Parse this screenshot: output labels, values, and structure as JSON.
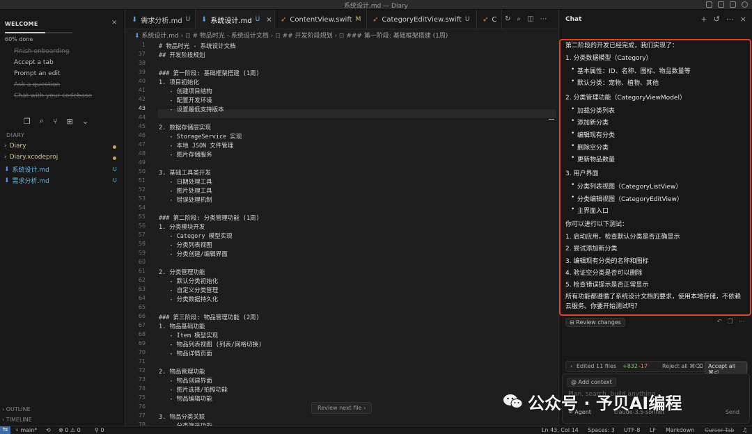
{
  "window": {
    "title": "系统设计.md — Diary"
  },
  "sidebar": {
    "welcome": {
      "title": "WELCOME",
      "progress_text": "60% done",
      "progress": 0.6
    },
    "onboarding": [
      {
        "label": "Finish onboarding",
        "done": true
      },
      {
        "label": "Accept a tab",
        "done": false
      },
      {
        "label": "Prompt an edit",
        "done": false
      },
      {
        "label": "Ask a question",
        "done": true
      },
      {
        "label": "Chat with your codebase",
        "done": true
      }
    ],
    "section": "DIARY",
    "files": [
      {
        "name": "Diary",
        "type": "folder",
        "status": "dot"
      },
      {
        "name": "Diary.xcodeproj",
        "type": "folder",
        "status": "dot"
      },
      {
        "name": "系统设计.md",
        "type": "md",
        "status": "U"
      },
      {
        "name": "需求分析.md",
        "type": "md",
        "status": "U"
      }
    ],
    "outline": "OUTLINE",
    "timeline": "TIMELINE"
  },
  "tabs": [
    {
      "label": "需求分析.md",
      "status": "U",
      "icon": "markdown-icon"
    },
    {
      "label": "系统设计.md",
      "status": "U",
      "icon": "markdown-icon",
      "active": true
    },
    {
      "label": "ContentView.swift",
      "status": "M",
      "icon": "swift-icon"
    },
    {
      "label": "CategoryEditView.swift",
      "status": "U",
      "icon": "swift-icon"
    },
    {
      "label": "C",
      "status": "",
      "icon": "swift-icon"
    }
  ],
  "breadcrumb": {
    "file": "系统设计.md",
    "h1": "# 物品时光 - 系统设计文档",
    "h2": "## 开发阶段规划",
    "h3": "### 第一阶段: 基础框架搭建 (1周)"
  },
  "editor": {
    "current_line": 43,
    "lines": [
      {
        "n": 1,
        "text": "# 物品时光 - 系统设计文档"
      },
      {
        "n": 37,
        "text": "## 开发阶段规划"
      },
      {
        "n": 38,
        "text": ""
      },
      {
        "n": 39,
        "text": "### 第一阶段: 基础框架搭建 (1周)"
      },
      {
        "n": 40,
        "text": "1. 项目初始化"
      },
      {
        "n": 41,
        "text": "   - 创建项目结构"
      },
      {
        "n": 42,
        "text": "   - 配置开发环境"
      },
      {
        "n": 43,
        "text": "   - 设置最低支持版本"
      },
      {
        "n": 44,
        "text": ""
      },
      {
        "n": 45,
        "text": "2. 数据存储层实现"
      },
      {
        "n": 46,
        "text": "   - StorageService 实现"
      },
      {
        "n": 47,
        "text": "   - 本地 JSON 文件管理"
      },
      {
        "n": 48,
        "text": "   - 图片存储服务"
      },
      {
        "n": 49,
        "text": ""
      },
      {
        "n": 50,
        "text": "3. 基础工具类开发"
      },
      {
        "n": 51,
        "text": "   - 日期处理工具"
      },
      {
        "n": 52,
        "text": "   - 图片处理工具"
      },
      {
        "n": 53,
        "text": "   - 错误处理机制"
      },
      {
        "n": 54,
        "text": ""
      },
      {
        "n": 55,
        "text": "### 第二阶段: 分类管理功能 (1周)"
      },
      {
        "n": 56,
        "text": "1. 分类模块开发"
      },
      {
        "n": 57,
        "text": "   - Category 模型实现"
      },
      {
        "n": 58,
        "text": "   - 分类列表视图"
      },
      {
        "n": 59,
        "text": "   - 分类创建/编辑界面"
      },
      {
        "n": 60,
        "text": ""
      },
      {
        "n": 61,
        "text": "2. 分类管理功能"
      },
      {
        "n": 62,
        "text": "   - 默认分类初始化"
      },
      {
        "n": 63,
        "text": "   - 自定义分类管理"
      },
      {
        "n": 64,
        "text": "   - 分类数据持久化"
      },
      {
        "n": 65,
        "text": ""
      },
      {
        "n": 66,
        "text": "### 第三阶段: 物品管理功能 (2周)"
      },
      {
        "n": 67,
        "text": "1. 物品基础功能"
      },
      {
        "n": 68,
        "text": "   - Item 模型实现"
      },
      {
        "n": 69,
        "text": "   - 物品列表视图 (列表/网格切换)"
      },
      {
        "n": 70,
        "text": "   - 物品详情页面"
      },
      {
        "n": 71,
        "text": ""
      },
      {
        "n": 72,
        "text": "2. 物品管理功能"
      },
      {
        "n": 73,
        "text": "   - 物品创建界面"
      },
      {
        "n": 74,
        "text": "   - 图片选择/拍照功能"
      },
      {
        "n": 75,
        "text": "   - 物品编辑功能"
      },
      {
        "n": 76,
        "text": ""
      },
      {
        "n": 77,
        "text": "3. 物品分类关联"
      },
      {
        "n": 78,
        "text": "   - 分类筛选功能"
      }
    ],
    "review_next": "Review next file"
  },
  "chat": {
    "title": "Chat",
    "message": {
      "intro": "第二阶段的开发已经完成，我们实现了：",
      "s1": "1. 分类数据模型（Category）",
      "s1_items": [
        "基本属性：ID、名称、图标、物品数量等",
        "默认分类：宠物、植物、其他"
      ],
      "s2": "2. 分类管理功能（CategoryViewModel）",
      "s2_items": [
        "加载分类列表",
        "添加新分类",
        "编辑现有分类",
        "删除空分类",
        "更新物品数量"
      ],
      "s3": "3. 用户界面",
      "s3_items": [
        "分类列表视图（CategoryListView）",
        "分类编辑视图（CategoryEditView）",
        "主界面入口"
      ],
      "test_intro": "你可以进行以下测试：",
      "tests": [
        "1. 启动应用，检查默认分类是否正确显示",
        "2. 尝试添加新分类",
        "3. 编辑现有分类的名称和图标",
        "4. 验证空分类是否可以删除",
        "5. 检查错误提示是否正常显示"
      ],
      "closing": "所有功能都遵循了系统设计文档的要求，使用本地存储，不依赖云服务。你要开始测试吗？"
    },
    "review_changes": "Review changes",
    "edited": {
      "label": "Edited 11 files",
      "added": "+832",
      "removed": "-17",
      "reject": "Reject all ⌘⌫",
      "accept": "Accept all ⌘⏎"
    },
    "composer": {
      "add_context": "Add context",
      "placeholder": "Plan, search, build anything",
      "mode": "Agent",
      "model": "claude-3.5-sonnet",
      "send": "Send"
    }
  },
  "statusbar": {
    "branch": "main*",
    "problems": "⊗ 0 ⚠ 0",
    "ports": "0",
    "position": "Ln 43, Col 14",
    "spaces": "Spaces: 3",
    "encoding": "UTF-8",
    "eol": "LF",
    "language": "Markdown",
    "cursor_tab": "Cursor Tab"
  },
  "watermark": "公众号 · 予贝AI编程",
  "colors": {
    "accent": "#3b6ea8",
    "highlight_border": "#d8442b",
    "modified": "#d5c46b",
    "untracked": "#6fb3e0"
  }
}
